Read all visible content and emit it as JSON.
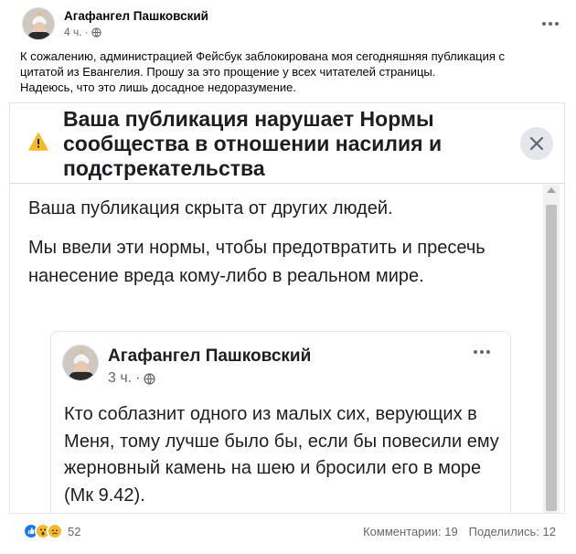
{
  "post": {
    "author": "Агафангел Пашковский",
    "time": "4 ч.",
    "separator": "·",
    "text_lines": [
      "К сожалению, администрацией Фейсбук заблокирована моя сегодняшняя публикация с",
      "цитатой из Евангелия. Прошу за это прощение у всех читателей страницы.",
      "Надеюсь, что это лишь досадное недоразумение."
    ]
  },
  "panel": {
    "title": "Ваша публикация нарушает Нормы сообщества в отношении насилия и подстрекательства",
    "body_1": "Ваша публикация скрыта от других людей.",
    "body_2": "Мы ввели эти нормы, чтобы предотвратить и пресечь нанесение вреда кому-либо в реальном мире.",
    "warning_icon": "warning-triangle-icon",
    "warning_color": "#f7b928"
  },
  "quoted_post": {
    "author": "Агафангел Пашковский",
    "time": "3 ч.",
    "separator": "·",
    "text": "Кто соблазнит одного из малых сих, верующих в Меня, тому лучше было бы, если бы повесили ему жерновный камень на шею и бросили его в море (Мк 9.42)."
  },
  "footer": {
    "reaction_count": "52",
    "comments": "Комментарии: 19",
    "shares": "Поделились: 12"
  }
}
